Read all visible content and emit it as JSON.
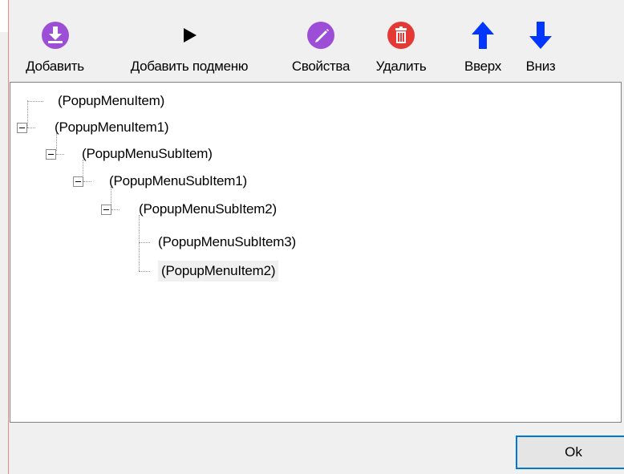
{
  "toolbar": {
    "buttons": [
      {
        "id": "add",
        "label": "Добавить",
        "icon": "download-icon",
        "color": "#9c4fd6"
      },
      {
        "id": "add_submenu",
        "label": "Добавить подменю",
        "icon": "play-arrow-icon",
        "color": "#000000"
      },
      {
        "id": "properties",
        "label": "Свойства",
        "icon": "pencil-icon",
        "color": "#9c4fd6"
      },
      {
        "id": "delete",
        "label": "Удалить",
        "icon": "trash-icon",
        "color": "#e53935"
      },
      {
        "id": "up",
        "label": "Вверх",
        "icon": "arrow-up-icon",
        "color": "#0036ff"
      },
      {
        "id": "down",
        "label": "Вниз",
        "icon": "arrow-down-icon",
        "color": "#0036ff"
      }
    ]
  },
  "tree": {
    "items": [
      {
        "label": "(PopupMenuItem)",
        "level": 0,
        "expandable": false,
        "selected": false
      },
      {
        "label": "(PopupMenuItem1)",
        "level": 0,
        "expandable": true,
        "expanded": true,
        "selected": false
      },
      {
        "label": "(PopupMenuSubItem)",
        "level": 1,
        "expandable": true,
        "expanded": true,
        "selected": false
      },
      {
        "label": "(PopupMenuSubItem1)",
        "level": 2,
        "expandable": true,
        "expanded": true,
        "selected": false
      },
      {
        "label": "(PopupMenuSubItem2)",
        "level": 3,
        "expandable": true,
        "expanded": true,
        "selected": false
      },
      {
        "label": "(PopupMenuSubItem3)",
        "level": 4,
        "expandable": false,
        "selected": false
      },
      {
        "label": "(PopupMenuItem2)",
        "level": 4,
        "expandable": false,
        "selected": true
      }
    ]
  },
  "footer": {
    "ok_label": "Ok"
  }
}
